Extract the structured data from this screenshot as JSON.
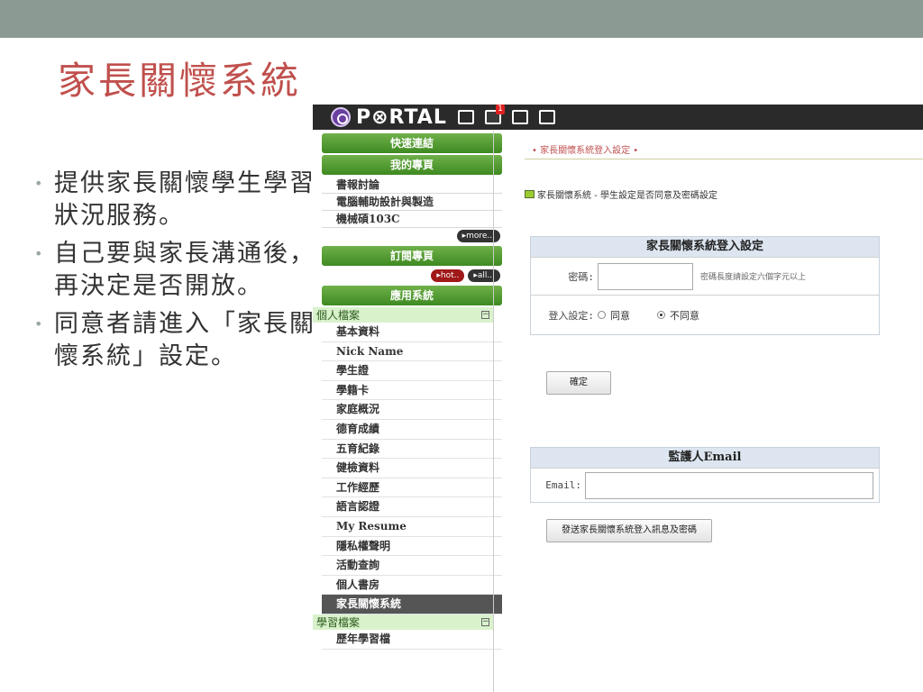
{
  "slide": {
    "title": "家長關懷系統",
    "bullets": [
      "提供家長關懷學生學習狀況服務。",
      "自己要與家長溝通後，再決定是否開放。",
      "同意者請進入「家長關懷系統」設定。"
    ]
  },
  "portal": {
    "logo_text": "P⊗RTAL",
    "icons": [
      "grid-icon",
      "chat-icon",
      "mail-icon",
      "calendar-icon"
    ],
    "chat_badge": "1"
  },
  "nav": {
    "quick_links": "快速連結",
    "my_page": "我的專頁",
    "my_items": [
      "書報討論",
      "電腦輔助設計與製造",
      "機械碩103C"
    ],
    "more": "▸more...",
    "subscribe": "訂閱專頁",
    "hot": "▸hot..",
    "all": "▸all...",
    "apps": "應用系統",
    "personal_section": "個人檔案",
    "personal_items": [
      "基本資料",
      "Nick Name",
      "學生證",
      "學籍卡",
      "家庭概況",
      "德育成績",
      "五育紀錄",
      "健檢資料",
      "工作經歷",
      "語言認證",
      "My Resume",
      "隱私權聲明",
      "活動查詢",
      "個人書房",
      "家長關懷系統"
    ],
    "active_item": "家長關懷系統",
    "learning_section": "學習檔案",
    "learning_items": [
      "歷年學習檔"
    ]
  },
  "content": {
    "breadcrumb": "• 家長關懷系統登入設定 •",
    "note": "家長關懷系統 - 學生設定是否同意及密碼設定",
    "login_panel_title": "家長關懷系統登入設定",
    "password_label": "密碼:",
    "password_value": "",
    "password_hint": "密碼長度請設定六個字元以上",
    "setting_label": "登入設定:",
    "agree_label": "同意",
    "disagree_label": "不同意",
    "selected": "disagree",
    "confirm_button": "確定",
    "email_panel_title": "監護人Email",
    "email_label": "Email:",
    "email_value": "",
    "send_button": "發送家長關懷系統登入訊息及密碼"
  }
}
